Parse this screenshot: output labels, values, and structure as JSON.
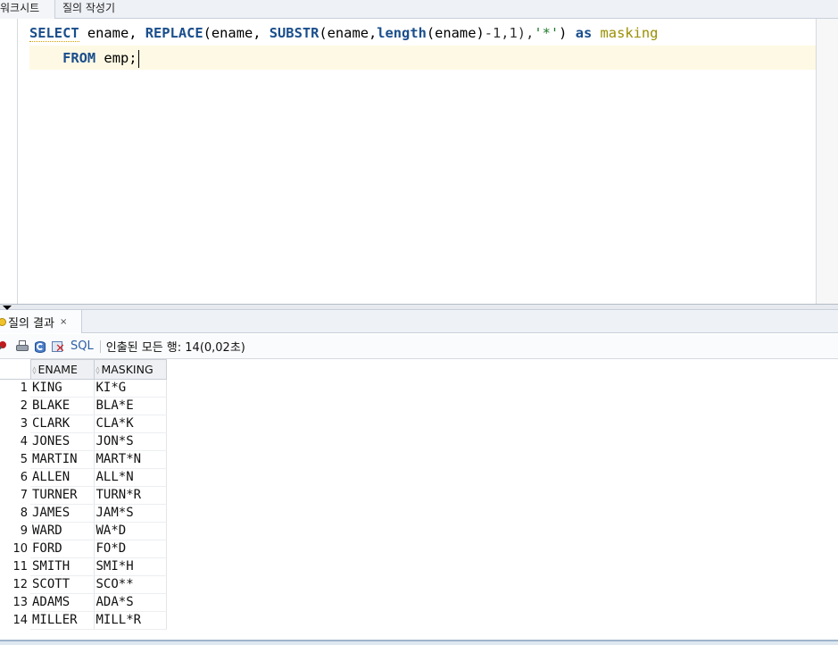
{
  "top_tabs": {
    "worksheet_label": "워크시트",
    "query_builder_label": "질의 작성기"
  },
  "editor": {
    "line1": {
      "select_kw": "SELECT",
      "t1": " ename, ",
      "replace_fn": "REPLACE",
      "t2": "(ename, ",
      "substr_fn": "SUBSTR",
      "t3": "(ename,",
      "length_fn": "length",
      "t4": "(ename)",
      "t5": "-1,1),",
      "star_str": "'*'",
      "t6": ") ",
      "as_kw": "as",
      "t7": " ",
      "alias": "masking"
    },
    "line2": {
      "indent": "    ",
      "from_kw": "FROM",
      "t1": " emp;"
    }
  },
  "result_panel": {
    "tab_label": "질의 결과",
    "tab_close": "×",
    "toolbar": {
      "sql_label": "SQL",
      "status_text": "인출된 모든 행: 14(0,02초)"
    },
    "columns": [
      "ENAME",
      "MASKING"
    ],
    "rows": [
      {
        "num": "1",
        "ename": "KING",
        "masking": "KI*G"
      },
      {
        "num": "2",
        "ename": "BLAKE",
        "masking": "BLA*E"
      },
      {
        "num": "3",
        "ename": "CLARK",
        "masking": "CLA*K"
      },
      {
        "num": "4",
        "ename": "JONES",
        "masking": "JON*S"
      },
      {
        "num": "5",
        "ename": "MARTIN",
        "masking": "MART*N"
      },
      {
        "num": "6",
        "ename": "ALLEN",
        "masking": "ALL*N"
      },
      {
        "num": "7",
        "ename": "TURNER",
        "masking": "TURN*R"
      },
      {
        "num": "8",
        "ename": "JAMES",
        "masking": "JAM*S"
      },
      {
        "num": "9",
        "ename": "WARD",
        "masking": "WA*D"
      },
      {
        "num": "10",
        "ename": "FORD",
        "masking": "FO*D"
      },
      {
        "num": "11",
        "ename": "SMITH",
        "masking": "SMI*H"
      },
      {
        "num": "12",
        "ename": "SCOTT",
        "masking": "SCO**"
      },
      {
        "num": "13",
        "ename": "ADAMS",
        "masking": "ADA*S"
      },
      {
        "num": "14",
        "ename": "MILLER",
        "masking": "MILL*R"
      }
    ]
  }
}
